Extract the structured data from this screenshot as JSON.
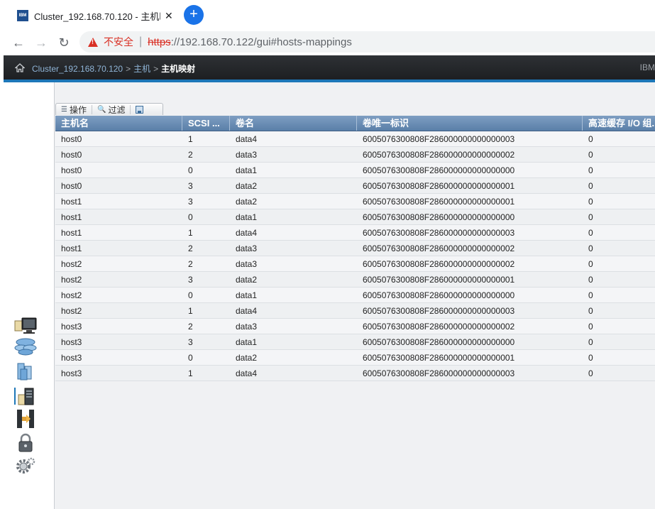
{
  "browser": {
    "tab_favicon": "IBM",
    "tab_title": "Cluster_192.168.70.120 - 主机映",
    "tab_close": "✕",
    "new_tab": "+",
    "back": "←",
    "forward": "→",
    "reload": "↻",
    "insecure_label": "不安全",
    "separator": "|",
    "url_scheme": "https",
    "url_rest": "://192.168.70.122/gui#hosts-mappings"
  },
  "header": {
    "crumbs": [
      "Cluster_192.168.70.120",
      "主机"
    ],
    "gt": ">",
    "current": "主机映射",
    "brand": "IBM"
  },
  "toolbar": {
    "actions_label": "操作",
    "filter_label": "过滤",
    "actions_icon": "☰",
    "filter_icon": "🔍"
  },
  "table": {
    "columns": [
      "主机名",
      "SCSI ...",
      "卷名",
      "卷唯一标识",
      "高速缓存 I/O 组..."
    ],
    "rows": [
      [
        "host0",
        "1",
        "data4",
        "6005076300808F286000000000000003",
        "0"
      ],
      [
        "host0",
        "2",
        "data3",
        "6005076300808F286000000000000002",
        "0"
      ],
      [
        "host0",
        "0",
        "data1",
        "6005076300808F286000000000000000",
        "0"
      ],
      [
        "host0",
        "3",
        "data2",
        "6005076300808F286000000000000001",
        "0"
      ],
      [
        "host1",
        "3",
        "data2",
        "6005076300808F286000000000000001",
        "0"
      ],
      [
        "host1",
        "0",
        "data1",
        "6005076300808F286000000000000000",
        "0"
      ],
      [
        "host1",
        "1",
        "data4",
        "6005076300808F286000000000000003",
        "0"
      ],
      [
        "host1",
        "2",
        "data3",
        "6005076300808F286000000000000002",
        "0"
      ],
      [
        "host2",
        "2",
        "data3",
        "6005076300808F286000000000000002",
        "0"
      ],
      [
        "host2",
        "3",
        "data2",
        "6005076300808F286000000000000001",
        "0"
      ],
      [
        "host2",
        "0",
        "data1",
        "6005076300808F286000000000000000",
        "0"
      ],
      [
        "host2",
        "1",
        "data4",
        "6005076300808F286000000000000003",
        "0"
      ],
      [
        "host3",
        "2",
        "data3",
        "6005076300808F286000000000000002",
        "0"
      ],
      [
        "host3",
        "3",
        "data1",
        "6005076300808F286000000000000000",
        "0"
      ],
      [
        "host3",
        "0",
        "data2",
        "6005076300808F286000000000000001",
        "0"
      ],
      [
        "host3",
        "1",
        "data4",
        "6005076300808F286000000000000003",
        "0"
      ]
    ]
  },
  "colors": {
    "header_bg": "#1c1e21",
    "accent_bar": "#1d77b8",
    "grid_header": "#5a7fa8"
  }
}
